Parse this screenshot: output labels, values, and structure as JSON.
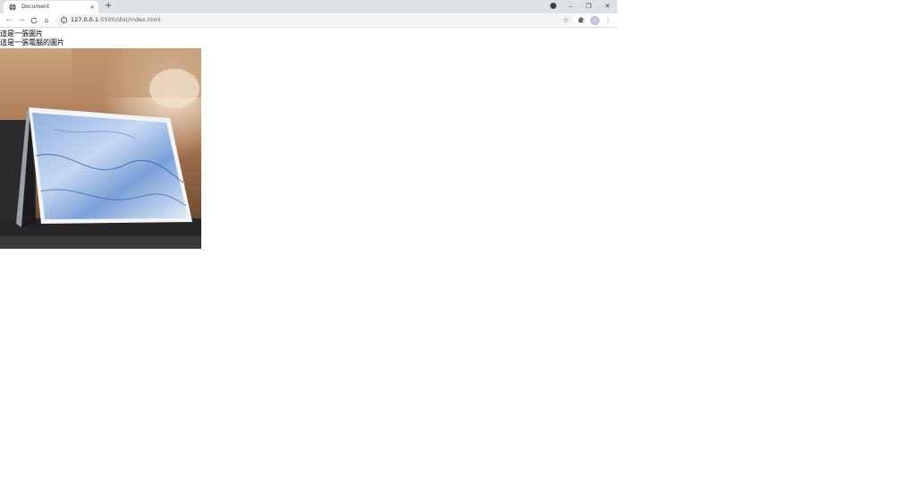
{
  "browser": {
    "tab": {
      "title": "Document",
      "close": "×"
    },
    "new_tab": "+",
    "window_controls": {
      "minimize": "–",
      "maximize": "❐",
      "close": "✕"
    },
    "nav": {
      "back": "←",
      "forward": "→",
      "reload": "C",
      "home": "⌂"
    },
    "address": {
      "host": "127.0.0.1",
      "rest": ":5500/dist/index.html"
    },
    "icons": [
      "globe-icon",
      "info-icon",
      "star-icon",
      "puzzle-icon",
      "avatar",
      "kebab-menu-icon"
    ]
  },
  "page": {
    "line1": "這是一張圖片",
    "line2": "這是一張電腦的圖片",
    "image": {
      "semantic": "laptop-photo"
    }
  }
}
